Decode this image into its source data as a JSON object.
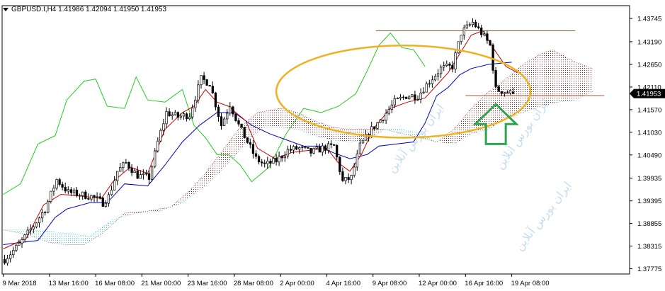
{
  "header": {
    "symbol_line": "GBPUSD.I,H4  1.41986 1.42094 1.41950 1.41953"
  },
  "colors": {
    "candle": "#000000",
    "tenkan": "#cc0000",
    "kijun": "#0000bb",
    "chikou": "#22cc22",
    "cloud_bear": "#8b1a1a",
    "cloud_bull": "#33cccc",
    "hline": "#b05030",
    "circle": "#f0b020",
    "arrow": "#2ea44f",
    "price_box": "#000000",
    "watermark": "#9ec9e6"
  },
  "chart_data": {
    "type": "candlestick",
    "symbol": "GBPUSD.I",
    "timeframe": "H4",
    "last_bar": {
      "open": 1.41986,
      "high": 1.42094,
      "low": 1.4195,
      "close": 1.41953
    },
    "ylim": [
      1.3765,
      1.4405
    ],
    "y_ticks": [
      "1.43745",
      "1.43190",
      "1.42650",
      "1.42110",
      "1.41570",
      "1.41030",
      "1.40490",
      "1.39935",
      "1.39395",
      "1.38855",
      "1.38315",
      "1.37775"
    ],
    "current_price_label": "1.41953",
    "x_ticks": [
      "9 Mar 2018",
      "13 Mar 16:00",
      "16 Mar 08:00",
      "21 Mar 00:00",
      "23 Mar 16:00",
      "28 Mar 08:00",
      "2 Apr 00:00",
      "4 Apr 16:00",
      "9 Apr 08:00",
      "12 Apr 00:00",
      "16 Apr 16:00",
      "19 Apr 08:00"
    ],
    "x_tick_bar_index": [
      0,
      16,
      32,
      48,
      64,
      80,
      96,
      112,
      128,
      144,
      160,
      176
    ],
    "x_range": [
      0,
      210
    ],
    "price_anchors": [
      [
        0,
        1.38
      ],
      [
        5,
        1.3835
      ],
      [
        10,
        1.388
      ],
      [
        14,
        1.392
      ],
      [
        18,
        1.399
      ],
      [
        22,
        1.396
      ],
      [
        26,
        1.3955
      ],
      [
        30,
        1.395
      ],
      [
        34,
        1.3935
      ],
      [
        36,
        1.395
      ],
      [
        39,
        1.401
      ],
      [
        42,
        1.403
      ],
      [
        46,
        1.4
      ],
      [
        50,
        1.3995
      ],
      [
        53,
        1.408
      ],
      [
        56,
        1.415
      ],
      [
        60,
        1.414
      ],
      [
        64,
        1.4145
      ],
      [
        68,
        1.423
      ],
      [
        71,
        1.422
      ],
      [
        75,
        1.412
      ],
      [
        78,
        1.417
      ],
      [
        81,
        1.412
      ],
      [
        84,
        1.408
      ],
      [
        87,
        1.404
      ],
      [
        90,
        1.4025
      ],
      [
        94,
        1.4035
      ],
      [
        98,
        1.406
      ],
      [
        102,
        1.4065
      ],
      [
        106,
        1.4055
      ],
      [
        110,
        1.4065
      ],
      [
        114,
        1.407
      ],
      [
        117,
        1.3985
      ],
      [
        120,
        1.3995
      ],
      [
        123,
        1.407
      ],
      [
        127,
        1.411
      ],
      [
        131,
        1.414
      ],
      [
        135,
        1.4175
      ],
      [
        139,
        1.419
      ],
      [
        143,
        1.419
      ],
      [
        147,
        1.4225
      ],
      [
        151,
        1.4255
      ],
      [
        155,
        1.426
      ],
      [
        158,
        1.434
      ],
      [
        162,
        1.4365
      ],
      [
        165,
        1.434
      ],
      [
        168,
        1.431
      ],
      [
        170,
        1.4205
      ],
      [
        173,
        1.42
      ],
      [
        176,
        1.4195
      ]
    ],
    "tenkan_sen": [
      [
        0,
        1.3825
      ],
      [
        8,
        1.385
      ],
      [
        14,
        1.393
      ],
      [
        20,
        1.3955
      ],
      [
        28,
        1.395
      ],
      [
        34,
        1.3945
      ],
      [
        38,
        1.3985
      ],
      [
        44,
        1.402
      ],
      [
        50,
        1.4005
      ],
      [
        56,
        1.411
      ],
      [
        62,
        1.415
      ],
      [
        66,
        1.4165
      ],
      [
        70,
        1.4205
      ],
      [
        74,
        1.4175
      ],
      [
        78,
        1.4165
      ],
      [
        84,
        1.413
      ],
      [
        88,
        1.4065
      ],
      [
        94,
        1.404
      ],
      [
        100,
        1.4055
      ],
      [
        106,
        1.406
      ],
      [
        112,
        1.4065
      ],
      [
        116,
        1.403
      ],
      [
        120,
        1.401
      ],
      [
        124,
        1.405
      ],
      [
        128,
        1.411
      ],
      [
        134,
        1.416
      ],
      [
        140,
        1.4175
      ],
      [
        146,
        1.4185
      ],
      [
        150,
        1.4215
      ],
      [
        154,
        1.4245
      ],
      [
        158,
        1.429
      ],
      [
        162,
        1.4335
      ],
      [
        166,
        1.4345
      ],
      [
        170,
        1.43
      ],
      [
        174,
        1.426
      ],
      [
        178,
        1.4245
      ]
    ],
    "kijun_sen": [
      [
        0,
        1.3835
      ],
      [
        12,
        1.3845
      ],
      [
        18,
        1.39
      ],
      [
        22,
        1.392
      ],
      [
        30,
        1.3935
      ],
      [
        36,
        1.3935
      ],
      [
        42,
        1.398
      ],
      [
        50,
        1.3975
      ],
      [
        56,
        1.4025
      ],
      [
        62,
        1.408
      ],
      [
        68,
        1.412
      ],
      [
        74,
        1.415
      ],
      [
        80,
        1.415
      ],
      [
        86,
        1.412
      ],
      [
        92,
        1.41
      ],
      [
        98,
        1.4085
      ],
      [
        104,
        1.407
      ],
      [
        110,
        1.407
      ],
      [
        114,
        1.4055
      ],
      [
        120,
        1.404
      ],
      [
        126,
        1.405
      ],
      [
        130,
        1.407
      ],
      [
        136,
        1.4075
      ],
      [
        142,
        1.408
      ],
      [
        146,
        1.4125
      ],
      [
        150,
        1.419
      ],
      [
        154,
        1.421
      ],
      [
        158,
        1.424
      ],
      [
        162,
        1.4255
      ],
      [
        168,
        1.4265
      ],
      [
        176,
        1.427
      ]
    ],
    "chikou_span": [
      [
        0,
        1.3955
      ],
      [
        6,
        1.398
      ],
      [
        12,
        1.4075
      ],
      [
        18,
        1.4095
      ],
      [
        22,
        1.418
      ],
      [
        28,
        1.4225
      ],
      [
        32,
        1.423
      ],
      [
        36,
        1.4165
      ],
      [
        42,
        1.416
      ],
      [
        46,
        1.4235
      ],
      [
        50,
        1.418
      ],
      [
        56,
        1.4175
      ],
      [
        62,
        1.4205
      ],
      [
        66,
        1.412
      ],
      [
        70,
        1.409
      ],
      [
        74,
        1.405
      ],
      [
        78,
        1.405
      ],
      [
        82,
        1.4025
      ],
      [
        86,
        1.3985
      ],
      [
        92,
        1.402
      ],
      [
        98,
        1.41
      ],
      [
        104,
        1.416
      ],
      [
        110,
        1.415
      ],
      [
        116,
        1.4165
      ],
      [
        122,
        1.4195
      ],
      [
        126,
        1.425
      ],
      [
        130,
        1.431
      ],
      [
        134,
        1.434
      ],
      [
        138,
        1.4305
      ],
      [
        142,
        1.43
      ],
      [
        146,
        1.426
      ]
    ],
    "senkou_span_a": [
      [
        0,
        1.387
      ],
      [
        10,
        1.387
      ],
      [
        18,
        1.3865
      ],
      [
        24,
        1.386
      ],
      [
        30,
        1.3855
      ],
      [
        38,
        1.3895
      ],
      [
        46,
        1.391
      ],
      [
        54,
        1.3915
      ],
      [
        62,
        1.3935
      ],
      [
        70,
        1.3975
      ],
      [
        78,
        1.403
      ],
      [
        84,
        1.408
      ],
      [
        90,
        1.4115
      ],
      [
        96,
        1.4115
      ],
      [
        102,
        1.411
      ],
      [
        108,
        1.4095
      ],
      [
        114,
        1.4085
      ],
      [
        120,
        1.408
      ],
      [
        126,
        1.4085
      ],
      [
        132,
        1.411
      ],
      [
        138,
        1.411
      ],
      [
        144,
        1.41
      ],
      [
        150,
        1.408
      ],
      [
        156,
        1.4075
      ],
      [
        162,
        1.41
      ],
      [
        168,
        1.411
      ],
      [
        174,
        1.4135
      ],
      [
        180,
        1.415
      ],
      [
        186,
        1.4165
      ],
      [
        192,
        1.4175
      ],
      [
        198,
        1.418
      ],
      [
        204,
        1.42
      ]
    ],
    "senkou_span_b": [
      [
        0,
        1.387
      ],
      [
        8,
        1.386
      ],
      [
        16,
        1.384
      ],
      [
        22,
        1.3835
      ],
      [
        28,
        1.3835
      ],
      [
        34,
        1.386
      ],
      [
        42,
        1.391
      ],
      [
        50,
        1.3915
      ],
      [
        58,
        1.3925
      ],
      [
        64,
        1.396
      ],
      [
        70,
        1.4005
      ],
      [
        76,
        1.406
      ],
      [
        82,
        1.4115
      ],
      [
        88,
        1.415
      ],
      [
        96,
        1.416
      ],
      [
        102,
        1.415
      ],
      [
        108,
        1.413
      ],
      [
        114,
        1.4115
      ],
      [
        120,
        1.411
      ],
      [
        126,
        1.411
      ],
      [
        132,
        1.411
      ],
      [
        138,
        1.41
      ],
      [
        144,
        1.409
      ],
      [
        150,
        1.408
      ],
      [
        156,
        1.411
      ],
      [
        162,
        1.416
      ],
      [
        168,
        1.42
      ],
      [
        174,
        1.423
      ],
      [
        180,
        1.4265
      ],
      [
        186,
        1.429
      ],
      [
        190,
        1.43
      ],
      [
        194,
        1.4285
      ],
      [
        198,
        1.427
      ],
      [
        204,
        1.4255
      ]
    ],
    "horizontal_levels": [
      {
        "price": 1.4345,
        "from_bar": 129,
        "to_bar": 198
      },
      {
        "price": 1.41905,
        "from_bar": 160,
        "to_bar": 208
      }
    ],
    "annotations": [
      {
        "type": "circle",
        "center_bar": 138,
        "price": 1.42,
        "rx_bars": 11,
        "ry_price": 0.005
      },
      {
        "type": "up-arrow",
        "bar": 170,
        "top_price": 1.417,
        "bottom_price": 1.4075
      }
    ],
    "watermark_text": "ایران بورس آنلاین",
    "grid": false,
    "legend": "none"
  }
}
